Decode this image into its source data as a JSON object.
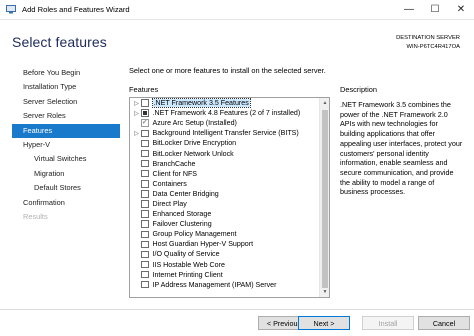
{
  "window": {
    "title": "Add Roles and Features Wizard",
    "minimize_glyph": "—",
    "maximize_glyph": "☐",
    "close_glyph": "✕"
  },
  "header": {
    "page_title": "Select features",
    "destination_label": "DESTINATION SERVER",
    "destination_server": "WIN-P6TC4R417OA"
  },
  "nav": {
    "items": [
      {
        "label": "Before You Begin",
        "state": "normal"
      },
      {
        "label": "Installation Type",
        "state": "normal"
      },
      {
        "label": "Server Selection",
        "state": "normal"
      },
      {
        "label": "Server Roles",
        "state": "normal"
      },
      {
        "label": "Features",
        "state": "selected"
      },
      {
        "label": "Hyper-V",
        "state": "normal"
      },
      {
        "label": "Virtual Switches",
        "state": "sub"
      },
      {
        "label": "Migration",
        "state": "sub"
      },
      {
        "label": "Default Stores",
        "state": "sub"
      },
      {
        "label": "Confirmation",
        "state": "normal"
      },
      {
        "label": "Results",
        "state": "disabled"
      }
    ]
  },
  "main": {
    "instruction": "Select one or more features to install on the selected server.",
    "features_label": "Features",
    "description_label": "Description",
    "description_text": ".NET Framework 3.5 combines the power of the .NET Framework 2.0 APIs with new technologies for building applications that offer appealing user interfaces, protect your customers' personal identity information, enable seamless and secure communication, and provide the ability to model a range of business processes.",
    "features": [
      {
        "label": ".NET Framework 3.5 Features",
        "expandable": true,
        "check": "none",
        "selected": true
      },
      {
        "label": ".NET Framework 4.8 Features (2 of 7 installed)",
        "expandable": true,
        "check": "partial",
        "selected": false
      },
      {
        "label": "Azure Arc Setup (Installed)",
        "expandable": false,
        "check": "checked",
        "selected": false
      },
      {
        "label": "Background Intelligent Transfer Service (BITS)",
        "expandable": true,
        "check": "none",
        "selected": false
      },
      {
        "label": "BitLocker Drive Encryption",
        "expandable": false,
        "check": "none",
        "selected": false
      },
      {
        "label": "BitLocker Network Unlock",
        "expandable": false,
        "check": "none",
        "selected": false
      },
      {
        "label": "BranchCache",
        "expandable": false,
        "check": "none",
        "selected": false
      },
      {
        "label": "Client for NFS",
        "expandable": false,
        "check": "none",
        "selected": false
      },
      {
        "label": "Containers",
        "expandable": false,
        "check": "none",
        "selected": false
      },
      {
        "label": "Data Center Bridging",
        "expandable": false,
        "check": "none",
        "selected": false
      },
      {
        "label": "Direct Play",
        "expandable": false,
        "check": "none",
        "selected": false
      },
      {
        "label": "Enhanced Storage",
        "expandable": false,
        "check": "none",
        "selected": false
      },
      {
        "label": "Failover Clustering",
        "expandable": false,
        "check": "none",
        "selected": false
      },
      {
        "label": "Group Policy Management",
        "expandable": false,
        "check": "none",
        "selected": false
      },
      {
        "label": "Host Guardian Hyper-V Support",
        "expandable": false,
        "check": "none",
        "selected": false
      },
      {
        "label": "I/O Quality of Service",
        "expandable": false,
        "check": "none",
        "selected": false
      },
      {
        "label": "IIS Hostable Web Core",
        "expandable": false,
        "check": "none",
        "selected": false
      },
      {
        "label": "Internet Printing Client",
        "expandable": false,
        "check": "none",
        "selected": false
      },
      {
        "label": "IP Address Management (IPAM) Server",
        "expandable": false,
        "check": "none",
        "selected": false
      }
    ],
    "expander_glyph": "▷"
  },
  "buttons": {
    "previous": "< Previous",
    "next": "Next >",
    "install": "Install",
    "cancel": "Cancel"
  }
}
